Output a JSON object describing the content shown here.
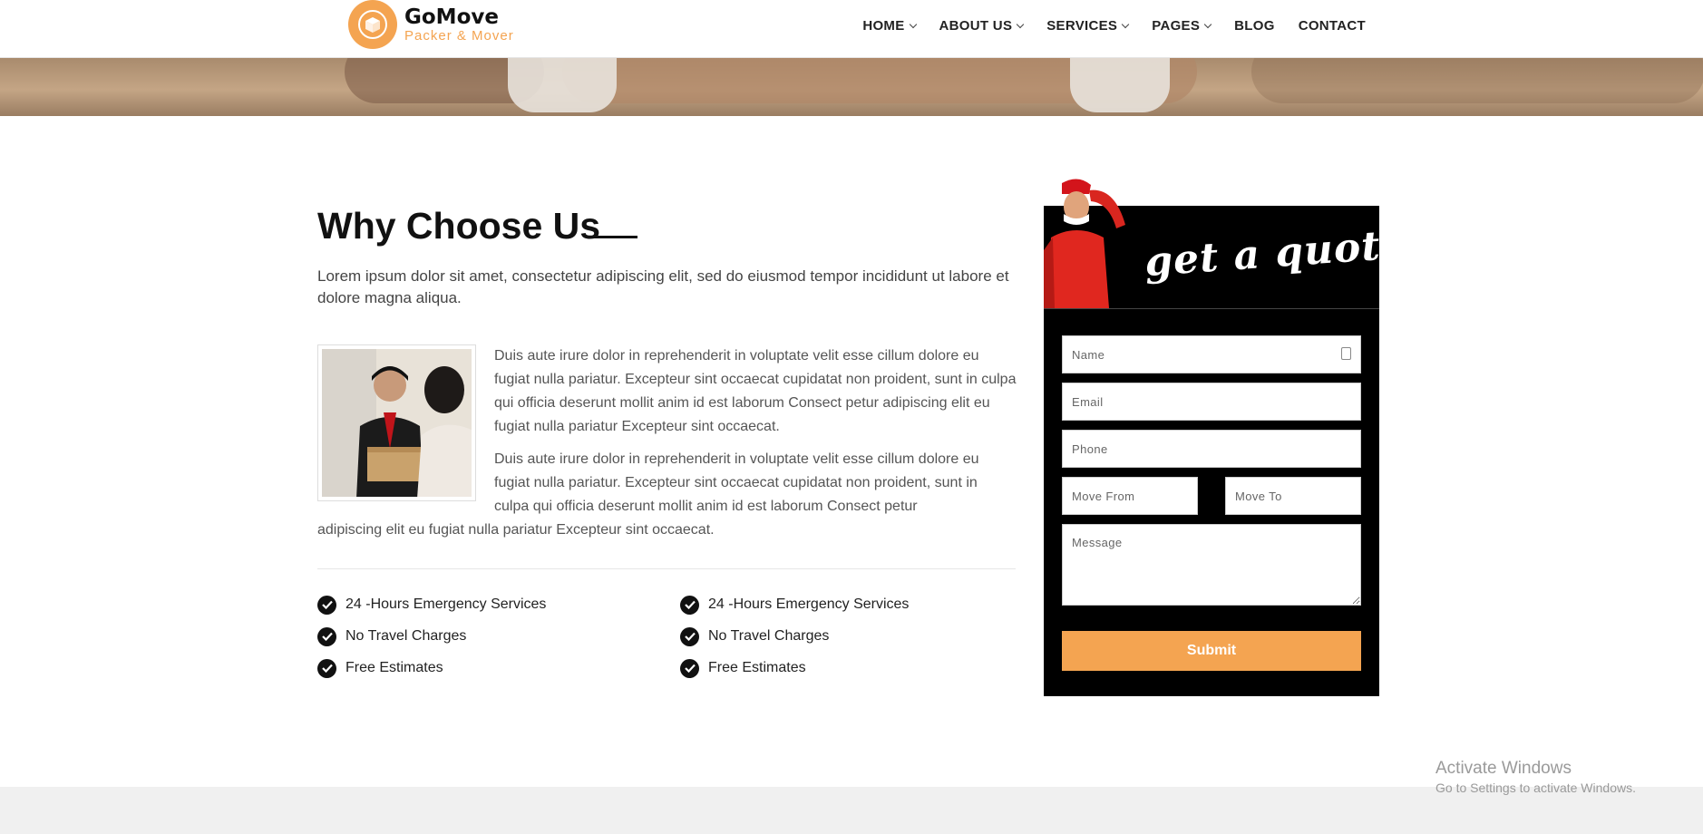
{
  "brand": {
    "name": "GoMove",
    "tagline": "Packer & Mover",
    "accent_color": "#f4a451"
  },
  "nav": {
    "items": [
      {
        "label": "HOME",
        "has_dropdown": true
      },
      {
        "label": "ABOUT US",
        "has_dropdown": true
      },
      {
        "label": "SERVICES",
        "has_dropdown": true
      },
      {
        "label": "PAGES",
        "has_dropdown": true
      },
      {
        "label": "BLOG",
        "has_dropdown": false
      },
      {
        "label": "CONTACT",
        "has_dropdown": false
      }
    ]
  },
  "section": {
    "heading": "Why Choose Us",
    "intro": "Lorem ipsum dolor sit amet, consectetur adipiscing elit, sed do eiusmod tempor incididunt ut labore et dolore magna aliqua.",
    "paragraph_1": "Duis aute irure dolor in reprehenderit in voluptate velit esse cillum dolore eu fugiat nulla pariatur. Excepteur sint occaecat cupidatat non proident, sunt in culpa qui officia deserunt mollit anim id est laborum Consect petur adipiscing elit eu fugiat nulla pariatur Excepteur sint occaecat.",
    "paragraph_2_lines": [
      "Duis aute irure dolor in reprehenderit in voluptate velit esse cillum dolore eu",
      "fugiat nulla pariatur. Excepteur sint occaecat cupidatat non proident, sunt in",
      "culpa qui officia deserunt mollit anim id est laborum Consect petur"
    ],
    "paragraph_2_tail": "adipiscing elit eu fugiat nulla pariatur Excepteur sint occaecat.",
    "features_left": [
      "24 -Hours Emergency Services",
      "No Travel Charges",
      "Free Estimates"
    ],
    "features_right": [
      "24 -Hours Emergency Services",
      "No Travel Charges",
      "Free Estimates"
    ]
  },
  "quote": {
    "title": "get a quote",
    "placeholders": {
      "name": "Name",
      "email": "Email",
      "phone": "Phone",
      "move_from": "Move From",
      "move_to": "Move To",
      "message": "Message"
    },
    "submit_label": "Submit"
  },
  "watermark": {
    "title": "Activate Windows",
    "subtitle": "Go to Settings to activate Windows."
  }
}
